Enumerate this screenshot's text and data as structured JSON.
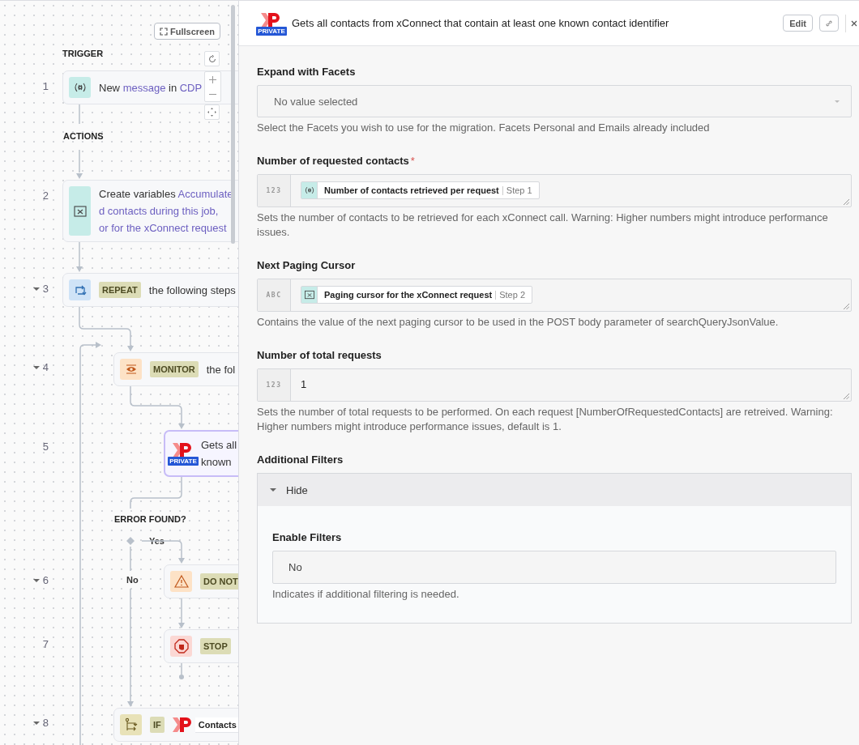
{
  "canvas": {
    "fullscreen_button": "Fullscreen",
    "labels": {
      "trigger": "TRIGGER",
      "actions": "ACTIONS",
      "condition": "ERROR FOUND?",
      "yes": "Yes",
      "no": "No"
    }
  },
  "steps": [
    {
      "number": "1",
      "expandable": false,
      "kind": "trigger",
      "lines": [
        [
          {
            "text": "New ",
            "ref": false
          },
          {
            "text": "message",
            "ref": true
          },
          {
            "text": " in ",
            "ref": false
          },
          {
            "text": "CDP",
            "ref": true
          }
        ]
      ]
    },
    {
      "number": "2",
      "expandable": false,
      "kind": "variables",
      "lines": [
        [
          {
            "text": "Create variables ",
            "ref": false
          },
          {
            "text": "Accumulate",
            "ref": true
          }
        ],
        [
          {
            "text": "d contacts during this job,",
            "ref": true
          }
        ],
        [
          {
            "text": "or for the xConnect request",
            "ref": true
          }
        ]
      ]
    },
    {
      "number": "3",
      "expandable": true,
      "kind": "repeat",
      "tag": "REPEAT",
      "lines": [
        [
          {
            "text": "the following steps",
            "ref": false
          }
        ]
      ]
    },
    {
      "number": "4",
      "expandable": true,
      "kind": "monitor",
      "tag": "MONITOR",
      "lines": [
        [
          {
            "text": "the fol",
            "ref": false
          }
        ]
      ]
    },
    {
      "number": "5",
      "expandable": false,
      "kind": "app",
      "badge": "PRIVATE",
      "lines": [
        [
          {
            "text": "Gets all",
            "ref": false
          }
        ],
        [
          {
            "text": "known",
            "ref": false
          }
        ]
      ]
    },
    {
      "number": "6",
      "expandable": true,
      "kind": "warning",
      "tag": "DO NOT"
    },
    {
      "number": "7",
      "expandable": false,
      "kind": "stop",
      "tag": "STOP"
    },
    {
      "number": "8",
      "expandable": true,
      "kind": "if",
      "tag": "IF",
      "chip": "Contacts"
    }
  ],
  "panel": {
    "title": "Gets all contacts from xConnect that contain at least one known contact identifier",
    "badge": "PRIVATE",
    "edit_button": "Edit",
    "fields": [
      {
        "kind": "select",
        "label": "Expand with Facets",
        "placeholder": "No value selected",
        "help": "Select the Facets you wish to use for the migration. Facets Personal and Emails already included"
      },
      {
        "kind": "expression",
        "label": "Number of requested contacts",
        "required_mark": "*",
        "prefix": "123",
        "chip": {
          "text": "Number of contacts retrieved per request",
          "step": "Step 1"
        },
        "help": "Sets the number of contacts to be retrieved for each xConnect call. Warning: Higher numbers might introduce performance issues."
      },
      {
        "kind": "expression",
        "label": "Next Paging Cursor",
        "prefix": "ABC",
        "chip": {
          "text": "Paging cursor for the xConnect request",
          "step": "Step 2"
        },
        "help": "Contains the value of the next paging cursor to be used in the POST body parameter of searchQueryJsonValue."
      },
      {
        "kind": "text",
        "label": "Number of total requests",
        "prefix": "123",
        "value": "1",
        "help": "Sets the number of total requests to be performed. On each request [NumberOfRequestedContacts] are retreived. Warning: Higher numbers might introduce performance issues, default is 1."
      },
      {
        "kind": "group",
        "label": "Additional Filters",
        "toggle": "Hide",
        "expanded": true,
        "children": [
          {
            "kind": "choice",
            "label": "Enable Filters",
            "value": "No",
            "help": "Indicates if additional filtering is needed."
          }
        ]
      }
    ]
  }
}
